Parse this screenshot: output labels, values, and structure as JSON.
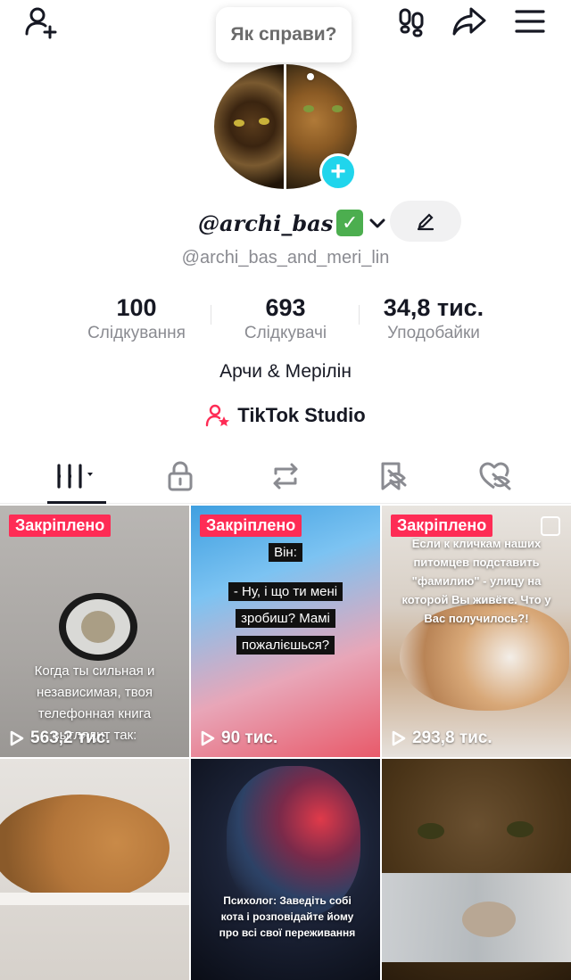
{
  "greeting_bubble": "Як справи?",
  "profile": {
    "display_name": "@archi_bas",
    "verified_emoji": "✅",
    "username": "@archi_bas_and_meri_lin",
    "bio": "Арчи & Мерілін",
    "studio_label": "TikTok Studio"
  },
  "stats": [
    {
      "value": "100",
      "label": "Слідкування"
    },
    {
      "value": "693",
      "label": "Слідкувачі"
    },
    {
      "value": "34,8 тис.",
      "label": "Уподобайки"
    }
  ],
  "tabs": [
    {
      "icon": "grid-icon"
    },
    {
      "icon": "lock-icon"
    },
    {
      "icon": "repost-icon"
    },
    {
      "icon": "bookmark-hidden-icon"
    },
    {
      "icon": "liked-hidden-icon"
    }
  ],
  "videos": [
    {
      "pinned_label": "Закріплено",
      "views": "563,2 тис.",
      "caption": "Когда ты сильная и независимая, твоя телефонная книга выглядит так:"
    },
    {
      "pinned_label": "Закріплено",
      "views": "90 тис.",
      "caption_lines": [
        "Він:",
        "- Ну, і що ти мені",
        "зробиш? Мамі",
        "пожалієшься?"
      ]
    },
    {
      "pinned_label": "Закріплено",
      "views": "293,8 тис.",
      "caption": "Если к кличкам наших питомцев подставить \"фамилию\" - улицу на которой Вы живёте. Что у Вас получилось?!"
    },
    {
      "caption": ""
    },
    {
      "caption": "Психолог: Заведіть собі кота і розповідайте йому про всі свої переживання"
    },
    {
      "caption": ""
    }
  ],
  "colors": {
    "accent": "#fe2c55",
    "plus_badge": "#20d5ec",
    "text_primary": "#161823",
    "text_secondary": "#8a8b91"
  }
}
